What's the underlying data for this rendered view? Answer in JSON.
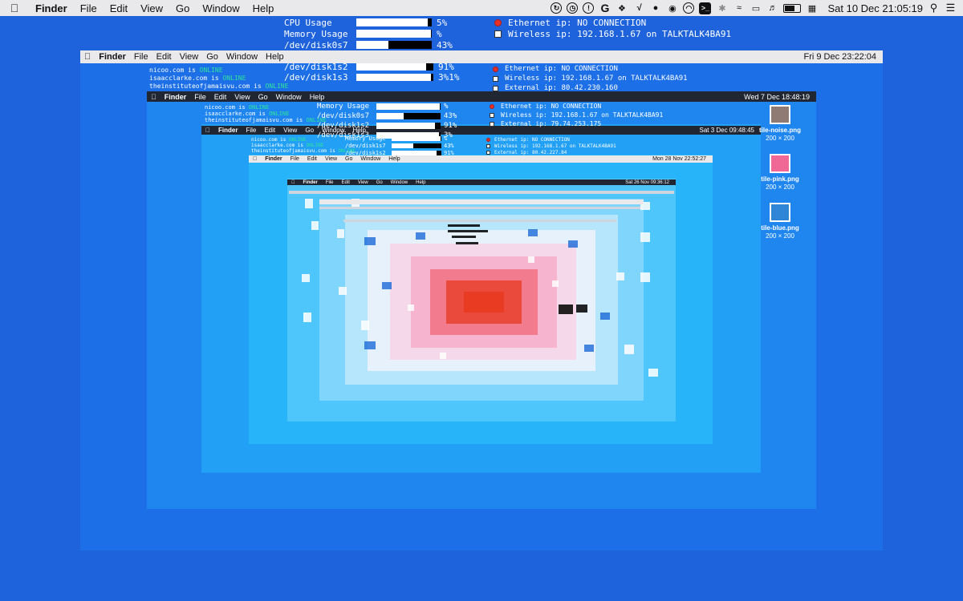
{
  "menubar": {
    "app_name": "Finder",
    "menus": [
      "File",
      "Edit",
      "View",
      "Go",
      "Window",
      "Help"
    ],
    "status_icons": [
      "sync-icon",
      "clock-icon",
      "info-icon",
      "grammarly-icon",
      "dropbox-icon",
      "script-icon",
      "evernote-icon",
      "github-icon",
      "timer-icon",
      "terminal-icon",
      "bluetooth-icon",
      "wifi-icon",
      "airplay-icon",
      "volume-icon",
      "battery-icon",
      "calendar-icon"
    ],
    "clock": "Sat 10 Dec  21:05:19"
  },
  "stats": [
    {
      "rows": [
        {
          "label": "CPU Usage",
          "level": 0.95,
          "pct": "5%"
        },
        {
          "label": "Memory Usage",
          "level": 0.99,
          "pct": "%"
        },
        {
          "label": "/dev/disk0s7",
          "level": 0.43,
          "pct": "43%"
        }
      ]
    },
    {
      "rows": [
        {
          "label": "/dev/disk1s2",
          "level": 0.91,
          "pct": "91%"
        },
        {
          "label": "/dev/disk1s3",
          "level": 0.97,
          "pct": "3%1%"
        }
      ]
    },
    {
      "rows": [
        {
          "label": "Memory Usage",
          "level": 0.99,
          "pct": "%"
        },
        {
          "label": "/dev/disk0s7",
          "level": 0.43,
          "pct": "43%"
        },
        {
          "label": "/dev/disk1s2",
          "level": 0.91,
          "pct": "91%"
        },
        {
          "label": "/dev/disk1s3",
          "level": 0.97,
          "pct": "3%"
        }
      ]
    },
    {
      "rows": [
        {
          "label": "Memory Usage",
          "level": 0.99,
          "pct": "%"
        },
        {
          "label": "/dev/disk1s7",
          "level": 0.43,
          "pct": "43%"
        },
        {
          "label": "/dev/disk1s2",
          "level": 0.91,
          "pct": "91%"
        }
      ]
    }
  ],
  "network": [
    {
      "rows": [
        {
          "status": "red",
          "text": "Ethernet ip: NO CONNECTION"
        },
        {
          "status": "white",
          "text": "Wireless ip: 192.168.1.67 on TALKTALK4BA91"
        }
      ]
    },
    {
      "rows": [
        {
          "status": "red",
          "text": "Ethernet ip: NO CONNECTION"
        },
        {
          "status": "white",
          "text": "Wireless ip: 192.168.1.67 on TALKTALK4BA91"
        },
        {
          "status": "white",
          "text": "External ip: 80.42.230.160"
        }
      ]
    },
    {
      "rows": [
        {
          "status": "red",
          "text": "Ethernet ip: NO CONNECTION"
        },
        {
          "status": "white",
          "text": "Wireless ip: 192.168.1.67 on TALKTALK4BA91"
        },
        {
          "status": "white",
          "text": "External ip: 79.74.253.175"
        }
      ]
    },
    {
      "rows": [
        {
          "status": "red",
          "text": "Ethernet ip: NO CONNECTION"
        },
        {
          "status": "white",
          "text": "Wireless ip: 192.168.1.67 on TALKTALK4BA91"
        },
        {
          "status": "white",
          "text": "External ip: 80.42.227.84"
        }
      ]
    }
  ],
  "sites": [
    {
      "rows": [
        {
          "host": "nicoo.com is ",
          "state": "ONLINE"
        },
        {
          "host": "isaacclarke.com is ",
          "state": "ONLINE"
        },
        {
          "host": "theinstituteofjamaisvu.com is ",
          "state": "ONLINE"
        }
      ]
    },
    {
      "rows": [
        {
          "host": "nicoo.com is ",
          "state": "ONLINE"
        },
        {
          "host": "isaacclarke.com is ",
          "state": "ONLINE"
        },
        {
          "host": "theinstituteofjamaisvu.com is ",
          "state": "ONLINE"
        }
      ]
    },
    {
      "rows": [
        {
          "host": "nicoo.com is ",
          "state": "ONLINE"
        },
        {
          "host": "isaacclarke.com is ",
          "state": "ONLINE"
        },
        {
          "host": "theinstituteofjamaisvu.com is ",
          "state": "ONLINE"
        }
      ]
    }
  ],
  "nested_menubars": [
    {
      "app": "Finder",
      "menus": [
        "File",
        "Edit",
        "View",
        "Go",
        "Window",
        "Help"
      ],
      "clock": "Fri 9 Dec  23:22:04"
    },
    {
      "app": "Finder",
      "menus": [
        "File",
        "Edit",
        "View",
        "Go",
        "Window",
        "Help"
      ],
      "clock": "Wed 7 Dec  18:48:19"
    },
    {
      "app": "Finder",
      "menus": [
        "File",
        "Edit",
        "View",
        "Go",
        "Window",
        "Help"
      ],
      "clock": "Sat 3 Dec  09:48:45"
    },
    {
      "app": "Finder",
      "menus": [
        "File",
        "Edit",
        "View",
        "Go",
        "Window",
        "Help"
      ],
      "clock": "Mon 28 Nov  22:52:27"
    },
    {
      "app": "Finder",
      "menus": [
        "File",
        "Edit",
        "View",
        "Go",
        "Window",
        "Help"
      ],
      "clock": "Sat 26 Nov  09:36:12"
    }
  ],
  "desktop_icons": [
    {
      "name": "tile-noise.png",
      "dims": "200 × 200",
      "color": "#8f7b74"
    },
    {
      "name": "tile-pink.png",
      "dims": "200 × 200",
      "color": "#f06895"
    },
    {
      "name": "tile-blue.png",
      "dims": "200 × 200",
      "color": "#2f86d6"
    }
  ],
  "colors": {
    "desktop": "#1e63db",
    "online": "#2ee39a",
    "menubar": "#e9e9ec"
  }
}
